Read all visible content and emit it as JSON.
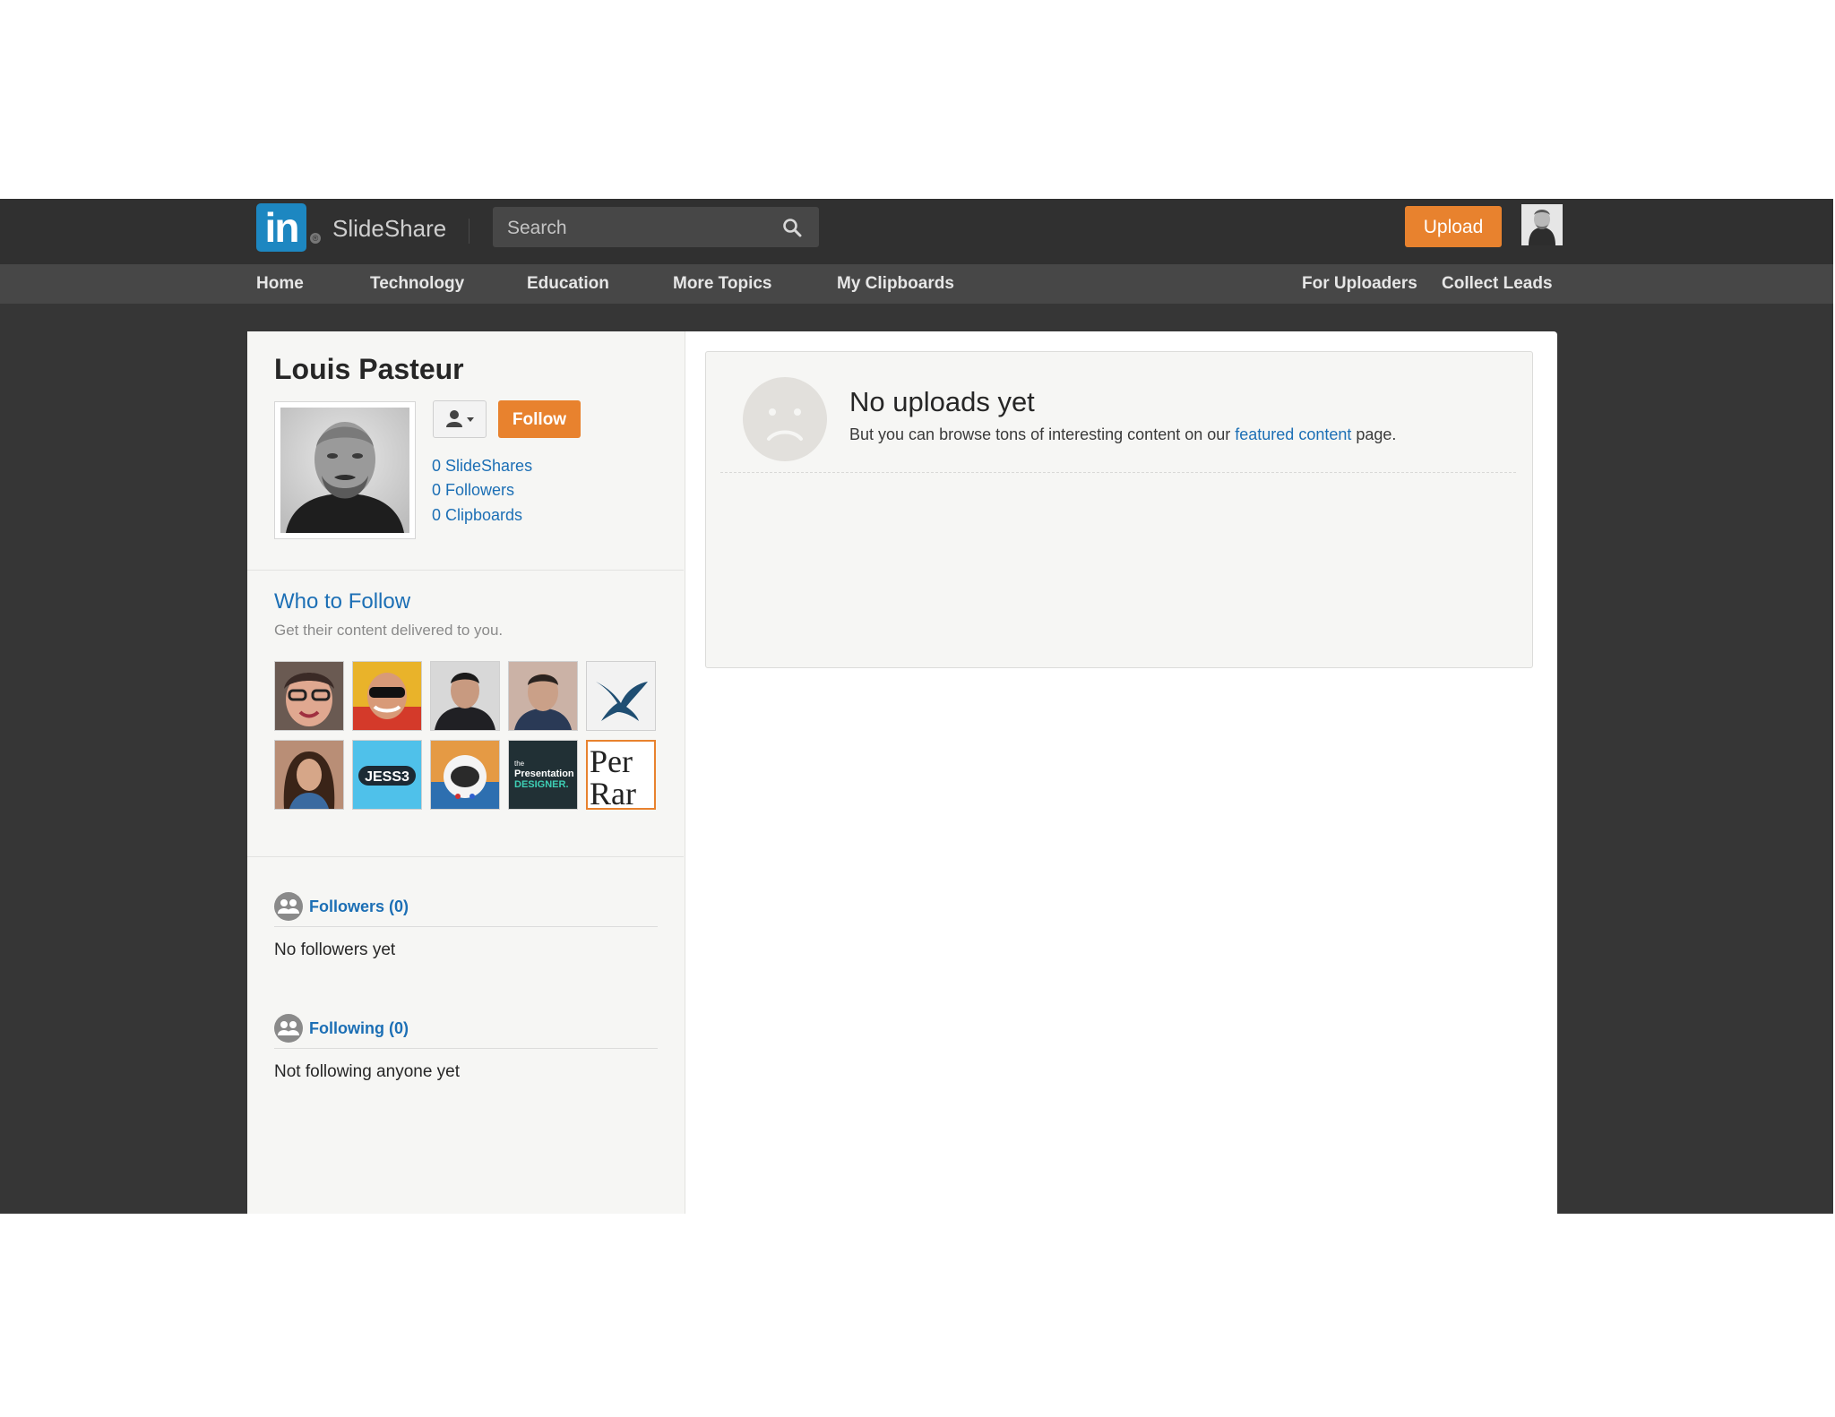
{
  "brand": {
    "logo_in": "in",
    "logo_reg": "®",
    "logo_text": "SlideShare",
    "color": "#1d87c1"
  },
  "search": {
    "placeholder": "Search",
    "icon": "search-icon"
  },
  "header": {
    "upload_label": "Upload",
    "upload_color": "#e8822e",
    "avatar_icon": "user-avatar"
  },
  "nav": {
    "left": [
      "Home",
      "Technology",
      "Education",
      "More Topics",
      "My Clipboards"
    ],
    "right": [
      "For Uploaders",
      "Collect Leads"
    ]
  },
  "profile": {
    "name": "Louis Pasteur",
    "follow_label": "Follow",
    "contact_icon": "person-dropdown-icon",
    "stats": [
      "0 SlideShares",
      "0 Followers",
      "0 Clipboards"
    ]
  },
  "who_to_follow": {
    "title": "Who to Follow",
    "subtitle": "Get their content delivered to you.",
    "tiles": [
      {
        "label": "",
        "bg": "#c9a08a"
      },
      {
        "label": "",
        "bg": "#e9b32a"
      },
      {
        "label": "",
        "bg": "#3a3a3f"
      },
      {
        "label": "",
        "bg": "#b49a8e"
      },
      {
        "label": "",
        "bg": "#f2f2f2"
      },
      {
        "label": "",
        "bg": "#5a3b30"
      },
      {
        "label": "JESS3",
        "bg": "#4fc1ea"
      },
      {
        "label": "",
        "bg": "#3d5c8a"
      },
      {
        "label": "the Presentation DESIGNER.",
        "bg": "#213035"
      },
      {
        "label": "Per Rar",
        "bg": "#ffffff"
      }
    ]
  },
  "followers": {
    "heading": "Followers (0)",
    "empty": "No followers yet"
  },
  "following": {
    "heading": "Following (0)",
    "empty": "Not following anyone yet"
  },
  "uploads": {
    "title": "No uploads yet",
    "text_before": "But you can browse tons of interesting content on our ",
    "link": "featured content",
    "text_after": " page."
  }
}
